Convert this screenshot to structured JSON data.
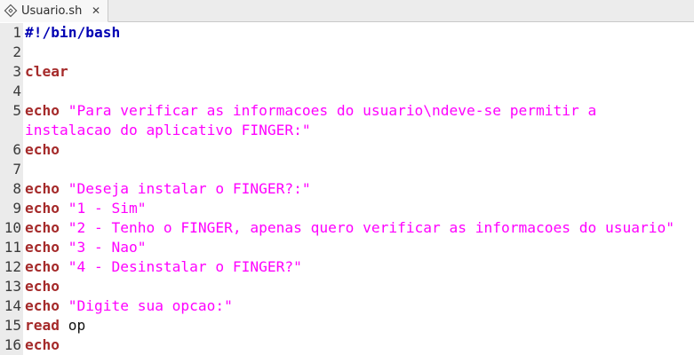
{
  "tab": {
    "title": "Usuario.sh",
    "close_icon": "close-icon",
    "file_icon": "file-icon"
  },
  "colors": {
    "keyword": "#a52a2a",
    "shebang": "#0000b3",
    "string": "#ff00ff",
    "gutter": "#ebebeb"
  },
  "lines": [
    {
      "num": "1",
      "shebang": "#!/bin/bash"
    },
    {
      "num": "2"
    },
    {
      "num": "3",
      "keyword": "clear"
    },
    {
      "num": "4"
    },
    {
      "num": "5",
      "keyword": "echo",
      "string": "\"Para verificar as informacoes do usuario\\ndeve-se permitir a"
    },
    {
      "num": "",
      "string": "instalacao do aplicativo FINGER:\""
    },
    {
      "num": "6",
      "keyword": "echo"
    },
    {
      "num": "7"
    },
    {
      "num": "8",
      "keyword": "echo",
      "string": "\"Deseja instalar o FINGER?:\""
    },
    {
      "num": "9",
      "keyword": "echo",
      "string": "\"1 - Sim\""
    },
    {
      "num": "10",
      "keyword": "echo",
      "string": "\"2 - Tenho o FINGER, apenas quero verificar as informacoes do usuario\""
    },
    {
      "num": "11",
      "keyword": "echo",
      "string": "\"3 - Nao\""
    },
    {
      "num": "12",
      "keyword": "echo",
      "string": "\"4 - Desinstalar o FINGER?\""
    },
    {
      "num": "13",
      "keyword": "echo"
    },
    {
      "num": "14",
      "keyword": "echo",
      "string": "\"Digite sua opcao:\""
    },
    {
      "num": "15",
      "keyword": "read",
      "plain": "op"
    },
    {
      "num": "16",
      "keyword": "echo"
    }
  ]
}
